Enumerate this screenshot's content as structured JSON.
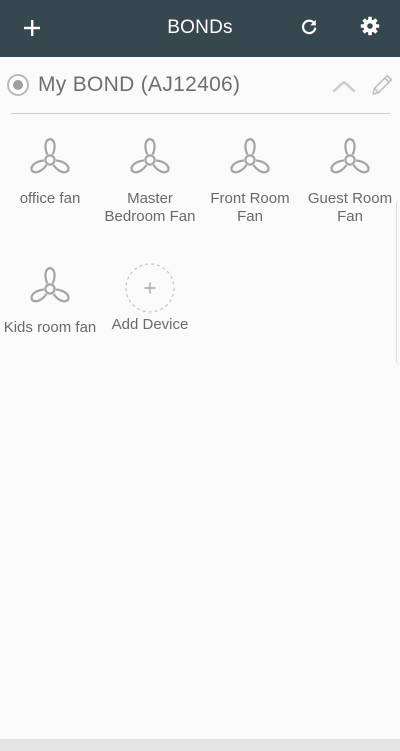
{
  "header": {
    "title": "BONDs",
    "add_icon": "plus-icon",
    "refresh_icon": "refresh-icon",
    "settings_icon": "gear-icon",
    "background": "#37474f"
  },
  "group": {
    "name": "My BOND (AJ12406)",
    "selected": true,
    "collapse_icon": "chevron-up-icon",
    "edit_icon": "pencil-icon"
  },
  "devices": [
    {
      "label": "office fan",
      "icon": "fan-icon"
    },
    {
      "label": "Master Bedroom Fan",
      "icon": "fan-icon"
    },
    {
      "label": "Front Room Fan",
      "icon": "fan-icon"
    },
    {
      "label": "Guest Room Fan",
      "icon": "fan-icon"
    },
    {
      "label": "Kids room fan",
      "icon": "fan-icon"
    }
  ],
  "add_device": {
    "label": "Add Device",
    "icon": "plus-circle-icon"
  }
}
